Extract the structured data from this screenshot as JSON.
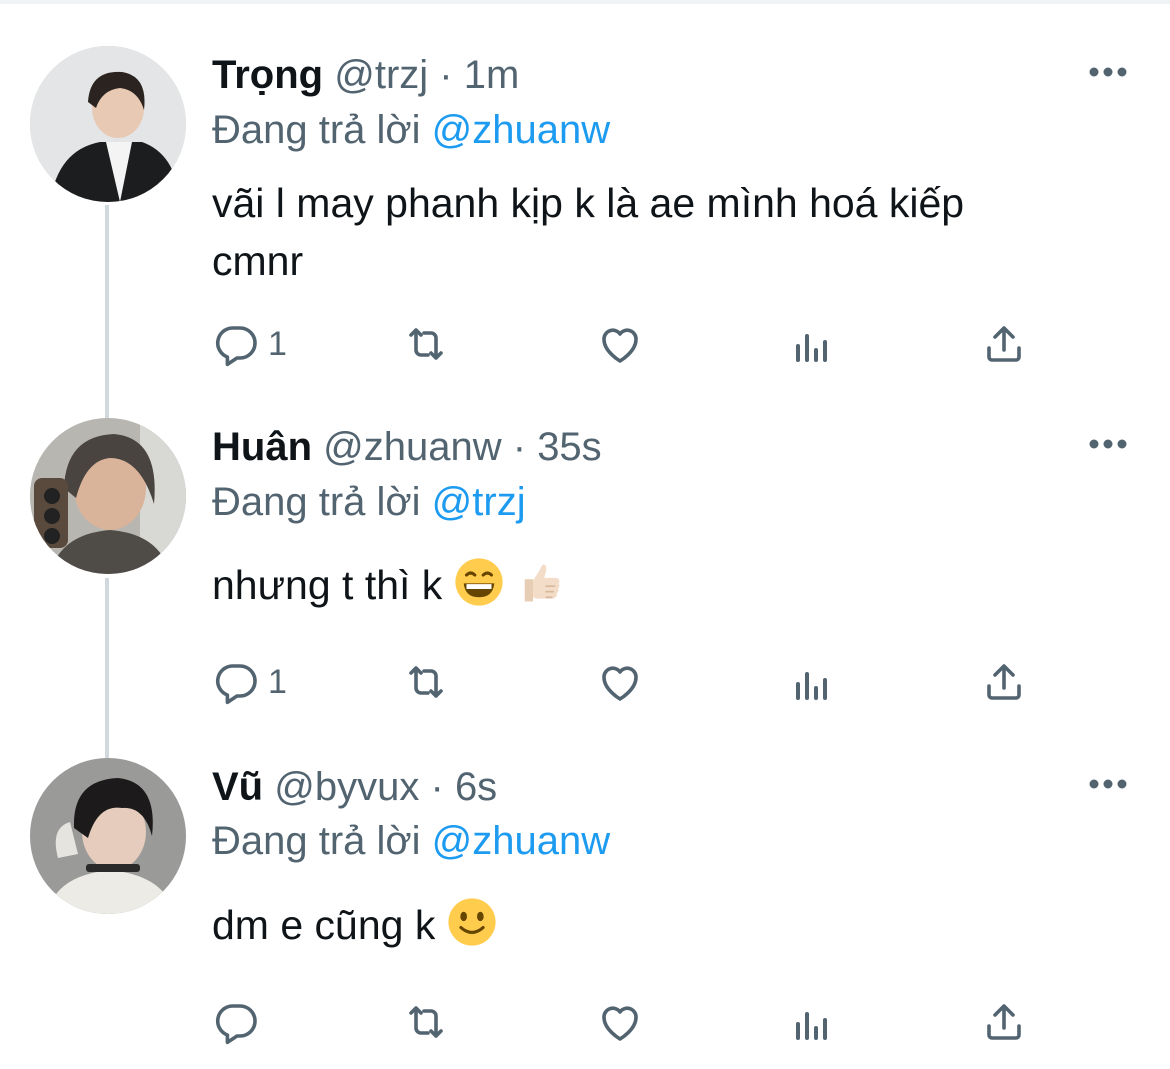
{
  "thread": {
    "tweets": [
      {
        "name": "Trọng",
        "handle": "@trzj",
        "separator": "·",
        "time": "1m",
        "reply_prefix": "Đang trả lời",
        "reply_to": "@zhuanw",
        "text_line1": "vãi l may phanh kịp k là ae mình hoá kiếp",
        "text_line2": "cmnr",
        "emojis": [],
        "reply_count": "1"
      },
      {
        "name": "Huân",
        "handle": "@zhuanw",
        "separator": "·",
        "time": "35s",
        "reply_prefix": "Đang trả lời",
        "reply_to": "@trzj",
        "text_line1": "nhưng t thì k",
        "emojis": [
          "grinning-face",
          "thumbs-up-light-skin"
        ],
        "reply_count": "1"
      },
      {
        "name": "Vũ",
        "handle": "@byvux",
        "separator": "·",
        "time": "6s",
        "reply_prefix": "Đang trả lời",
        "reply_to": "@zhuanw",
        "text_line1": "dm e cũng k",
        "emojis": [
          "slightly-smiling-face"
        ],
        "reply_count": ""
      }
    ]
  },
  "icons": {
    "actions": [
      "reply-icon",
      "retweet-icon",
      "like-icon",
      "views-icon",
      "share-icon"
    ],
    "more": "more-icon"
  },
  "colors": {
    "text": "#0f1419",
    "secondary": "#536471",
    "mention": "#1d9bf0",
    "thread_line": "#cfd9de"
  }
}
